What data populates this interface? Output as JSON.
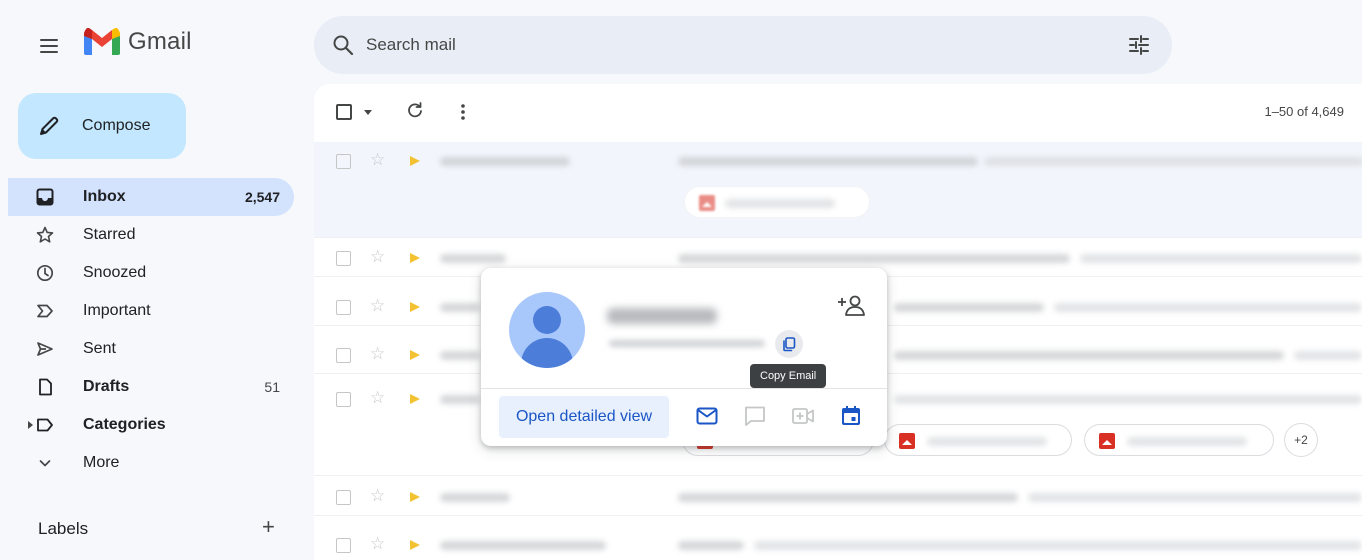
{
  "app": {
    "name": "Gmail"
  },
  "search": {
    "placeholder": "Search mail"
  },
  "compose": {
    "label": "Compose"
  },
  "sidebar": {
    "items": [
      {
        "label": "Inbox",
        "count": "2,547"
      },
      {
        "label": "Starred",
        "count": ""
      },
      {
        "label": "Snoozed",
        "count": ""
      },
      {
        "label": "Important",
        "count": ""
      },
      {
        "label": "Sent",
        "count": ""
      },
      {
        "label": "Drafts",
        "count": "51"
      },
      {
        "label": "Categories",
        "count": ""
      },
      {
        "label": "More",
        "count": ""
      }
    ],
    "labels_title": "Labels",
    "labels_add": "+"
  },
  "toolbar": {
    "pager": "1–50 of 4,649"
  },
  "attachments": {
    "more_count": "+2"
  },
  "hover_card": {
    "tooltip": "Copy Email",
    "open_detailed_view": "Open detailed view"
  },
  "colors": {
    "accent_blue": "#0b57d0",
    "compose_bg": "#c2e7ff",
    "inbox_active_bg": "#d3e3fd",
    "important_marker": "#f2c233",
    "attachment_red": "#d93025"
  }
}
